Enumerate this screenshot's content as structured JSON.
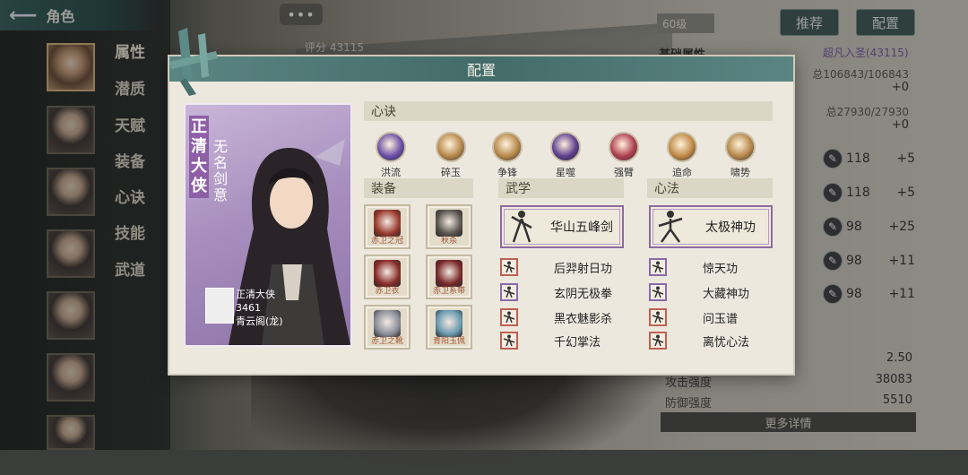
{
  "nav": {
    "back_label": "角色",
    "items": [
      "属性",
      "潜质",
      "天赋",
      "装备",
      "心诀",
      "技能",
      "武道"
    ]
  },
  "hud": {
    "chat_label": "•••",
    "score_label": "评分 43115",
    "level": "60级",
    "recommend": "推荐",
    "config": "配置",
    "section_title": "基础属性",
    "realm": "超凡入圣(43115)",
    "hp": "总106843/106843",
    "hp_plus": "+0",
    "mp": "总27930/27930",
    "mp_plus": "+0",
    "attr_rows": [
      {
        "n": "118",
        "v": "+5"
      },
      {
        "n": "118",
        "v": "+5"
      },
      {
        "n": "98",
        "v": "+25"
      },
      {
        "n": "98",
        "v": "+11"
      },
      {
        "n": "98",
        "v": "+11"
      }
    ],
    "val_250": "2.50",
    "atk_label": "攻击强度",
    "atk": "38083",
    "def_label": "防御强度",
    "def": "5510",
    "more": "更多详情"
  },
  "modal": {
    "title": "配置",
    "portrait": {
      "title": "正清大侠",
      "subtitle": "无名剑意",
      "name": "正清大侠",
      "score": "3461",
      "guild": "青云阁(龙)"
    },
    "xinjue_header": "心诀",
    "xinjue": [
      {
        "label": "洪流",
        "color": "#6b4fa8"
      },
      {
        "label": "碎玉",
        "color": "#b8894a"
      },
      {
        "label": "争锋",
        "color": "#b8894a"
      },
      {
        "label": "星噬",
        "color": "#5d3f8f"
      },
      {
        "label": "强臂",
        "color": "#b04052"
      },
      {
        "label": "追命",
        "color": "#c08a45"
      },
      {
        "label": "啸势",
        "color": "#b8894a"
      }
    ],
    "equip_header": "装备",
    "equip": [
      {
        "tag": "赤卫之冠",
        "color": "#9a3b2e"
      },
      {
        "tag": "秋杀",
        "color": "#5a5550"
      },
      {
        "tag": "赤卫衣",
        "color": "#8a2e2a"
      },
      {
        "tag": "赤卫系带",
        "color": "#7a2a2a"
      },
      {
        "tag": "赤卫之靴",
        "color": "#8b8f9a"
      },
      {
        "tag": "青阳玉佩",
        "color": "#6a9ab0"
      }
    ],
    "wuxue_header": "武学",
    "wuxue_main": "华山五峰剑",
    "wuxue": [
      "后羿射日功",
      "玄阴无极拳",
      "黑衣魅影杀",
      "千幻掌法"
    ],
    "xinfa_header": "心法",
    "xinfa_main": "太极神功",
    "xinfa": [
      "惊天功",
      "大藏神功",
      "问玉谱",
      "离忧心法"
    ]
  }
}
